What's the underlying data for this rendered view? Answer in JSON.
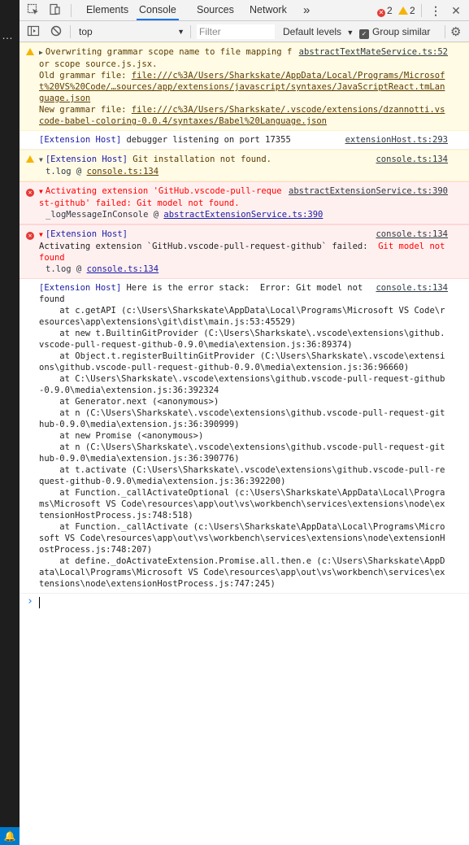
{
  "toolbar": {
    "tabs": [
      "Elements",
      "Console",
      "Sources",
      "Network"
    ],
    "more_label": "»",
    "error_count": "2",
    "warning_count": "2"
  },
  "filterbar": {
    "context": "top",
    "filter_placeholder": "Filter",
    "levels_label": "Default levels",
    "group_similar_label": "Group similar"
  },
  "messages": {
    "m1": {
      "text_a": "Overwriting grammar scope name to file mapping for scope source.js.jsx.",
      "text_b": "Old grammar file: ",
      "link_b": "file:///c%3A/Users/Sharkskate/AppData/Local/Programs/Microsoft%20VS%20Code/…sources/app/extensions/javascript/syntaxes/JavaScriptReact.tmLanguage.json",
      "text_c": "New grammar file: ",
      "link_c": "file:///c%3A/Users/Sharkskate/.vscode/extensions/dzannotti.vscode-babel-coloring-0.0.4/syntaxes/Babel%20Language.json",
      "source": "abstractTextMateService.ts:52"
    },
    "m2": {
      "prefix": "[Extension Host]",
      "text": " debugger listening on port 17355",
      "source": "extensionHost.ts:293"
    },
    "m3": {
      "prefix": "[Extension Host]",
      "text": " Git installation not found.",
      "source": "console.ts:134",
      "stack_fn": "t.log @ ",
      "stack_link": "console.ts:134"
    },
    "m4": {
      "text": "Activating extension 'GitHub.vscode-pull-request-github' failed: Git model not found.",
      "source": "abstractExtensionService.ts:390",
      "stack_fn": "_logMessageInConsole @ ",
      "stack_link": "abstractExtensionService.ts:390"
    },
    "m5": {
      "prefix": "[Extension Host]",
      "line": "Activating extension `GitHub.vscode-pull-request-github` failed: ",
      "err": " Git model not found",
      "source": "console.ts:134",
      "stack_fn": "t.log @ ",
      "stack_link": "console.ts:134"
    },
    "m6": {
      "prefix": "[Extension Host]",
      "text": " Here is the error stack:  Error: Git model not found\n    at c.getAPI (c:\\Users\\Sharkskate\\AppData\\Local\\Programs\\Microsoft VS Code\\resources\\app\\extensions\\git\\dist\\main.js:53:45529)\n    at new t.BuiltinGitProvider (C:\\Users\\Sharkskate\\.vscode\\extensions\\github.vscode-pull-request-github-0.9.0\\media\\extension.js:36:89374)\n    at Object.t.registerBuiltinGitProvider (C:\\Users\\Sharkskate\\.vscode\\extensions\\github.vscode-pull-request-github-0.9.0\\media\\extension.js:36:96660)\n    at C:\\Users\\Sharkskate\\.vscode\\extensions\\github.vscode-pull-request-github-0.9.0\\media\\extension.js:36:392324\n    at Generator.next (<anonymous>)\n    at n (C:\\Users\\Sharkskate\\.vscode\\extensions\\github.vscode-pull-request-github-0.9.0\\media\\extension.js:36:390999)\n    at new Promise (<anonymous>)\n    at n (C:\\Users\\Sharkskate\\.vscode\\extensions\\github.vscode-pull-request-github-0.9.0\\media\\extension.js:36:390776)\n    at t.activate (C:\\Users\\Sharkskate\\.vscode\\extensions\\github.vscode-pull-request-github-0.9.0\\media\\extension.js:36:392200)\n    at Function._callActivateOptional (c:\\Users\\Sharkskate\\AppData\\Local\\Programs\\Microsoft VS Code\\resources\\app\\out\\vs\\workbench\\services\\extensions\\node\\extensionHostProcess.js:748:518)\n    at Function._callActivate (c:\\Users\\Sharkskate\\AppData\\Local\\Programs\\Microsoft VS Code\\resources\\app\\out\\vs\\workbench\\services\\extensions\\node\\extensionHostProcess.js:748:207)\n    at define._doActivateExtension.Promise.all.then.e (c:\\Users\\Sharkskate\\AppData\\Local\\Programs\\Microsoft VS Code\\resources\\app\\out\\vs\\workbench\\services\\extensions\\node\\extensionHostProcess.js:747:245)",
      "source": "console.ts:134"
    }
  },
  "colors": {
    "warning_bg": "#fffbe5",
    "error_bg": "#fff0f0",
    "error_text": "#ff0000",
    "extension_host_blue": "#1a1aa6",
    "active_tab_accent": "#1a73e8"
  }
}
